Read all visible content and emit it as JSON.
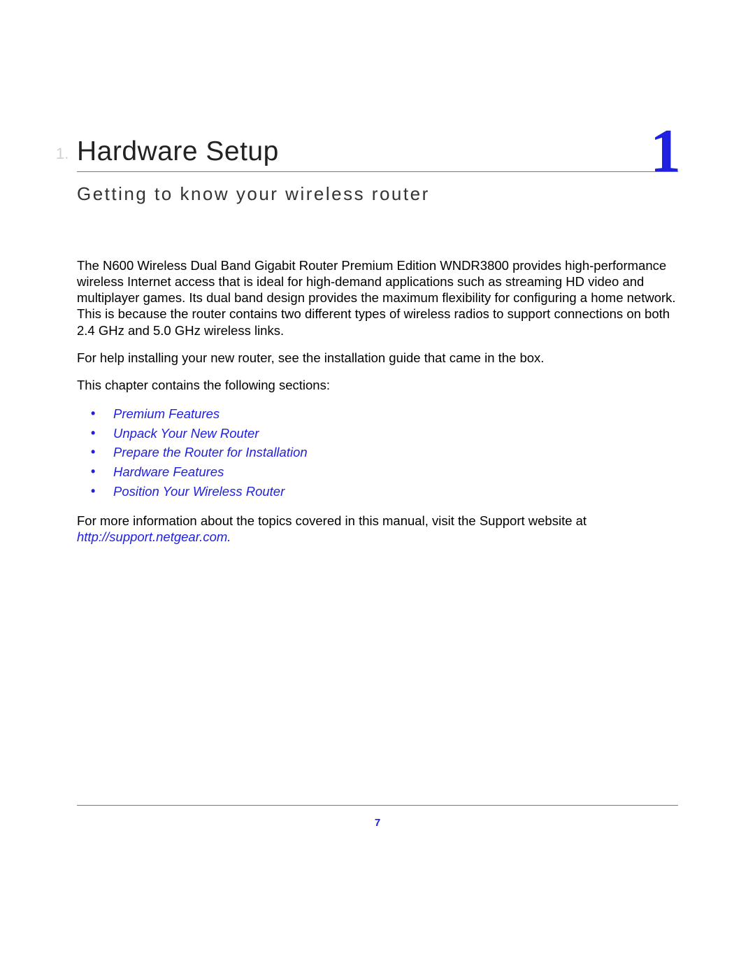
{
  "chapter": {
    "prefix": "1.",
    "title": "Hardware Setup",
    "number": "1",
    "subtitle": "Getting to know your wireless router"
  },
  "paragraphs": {
    "intro": "The N600 Wireless Dual Band Gigabit Router Premium Edition WNDR3800 provides high-performance wireless Internet access that is ideal for high-demand applications such as streaming HD video and multiplayer games. Its dual band design provides the maximum flexibility for configuring a home network. This is because the router contains two different types of wireless radios to support connections on both 2.4 GHz and 5.0 GHz wireless links.",
    "help": "For help installing your new router, see the installation guide that came in the box.",
    "sections_intro": "This chapter contains the following sections:",
    "more_info": "For more information about the topics covered in this manual, visit the Support website at ",
    "support_url": "http://support.netgear.com."
  },
  "sections": [
    "Premium Features",
    "Unpack Your New Router",
    "Prepare the Router for Installation",
    "Hardware Features",
    "Position Your Wireless Router"
  ],
  "page_number": "7"
}
